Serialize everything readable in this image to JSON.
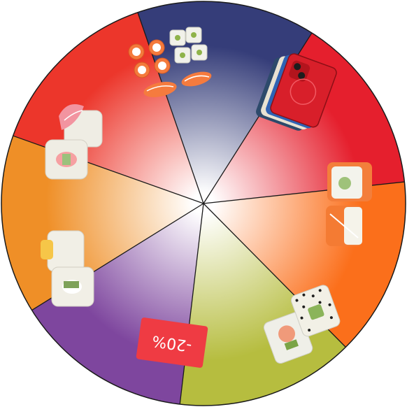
{
  "wheel": {
    "segments": [
      {
        "id": "sushi-set",
        "color": "#353d79",
        "icon": "sushi-set-icon"
      },
      {
        "id": "phone",
        "color": "#e51f2d",
        "icon": "smartphone-icon"
      },
      {
        "id": "salmon-roll",
        "color": "#fb6f1b",
        "icon": "salmon-roll-icon"
      },
      {
        "id": "sesame-roll",
        "color": "#b6bd3f",
        "icon": "sesame-roll-icon"
      },
      {
        "id": "discount",
        "color": "#7e469e",
        "icon": "discount-card-icon"
      },
      {
        "id": "tamago-roll",
        "color": "#ef8f27",
        "icon": "tamago-roll-icon"
      },
      {
        "id": "ginger-roll",
        "color": "#ec362b",
        "icon": "ginger-roll-icon"
      }
    ],
    "discount_label": "-20%"
  }
}
